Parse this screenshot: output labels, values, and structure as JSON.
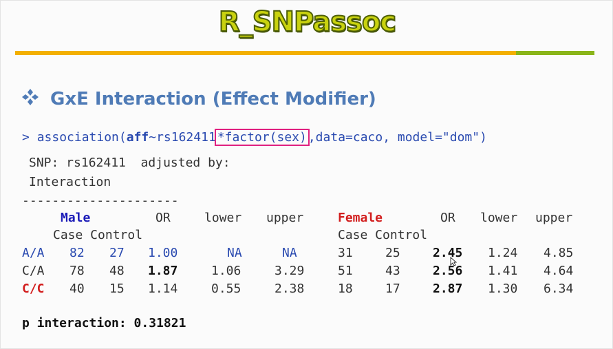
{
  "slide": {
    "title": "R_SNPassoc",
    "heading": "GxE Interaction (Effect Modifier)",
    "command": {
      "prompt": ">",
      "func_open": "association(",
      "aff": "aff",
      "formula_mid": "~rs162411",
      "boxed": "*factor(sex)",
      "tail": ",data=caco, model=\"dom\")"
    },
    "output": {
      "line1": "SNP: rs162411  adjusted by:",
      "line2": "Interaction",
      "dashes": "---------------------",
      "male_label": "Male",
      "female_label": "Female",
      "col_or": "OR",
      "col_lower": "lower",
      "col_upper": "upper",
      "col_or2": "OR",
      "col_lower2": "lower",
      "col_upper2": "upper",
      "subheader_male": "Case Control",
      "subheader_female": "Case Control",
      "rows": [
        {
          "genotype": "A/A",
          "m_case": "82",
          "m_ctrl": "27",
          "m_or": "1.00",
          "m_lower": "NA",
          "m_upper": "NA",
          "f_case": "31",
          "f_ctrl": "25",
          "f_or": "2.45",
          "f_lower": "1.24",
          "f_upper": "4.85"
        },
        {
          "genotype": "C/A",
          "m_case": "78",
          "m_ctrl": "48",
          "m_or": "1.87",
          "m_lower": "1.06",
          "m_upper": "3.29",
          "f_case": "51",
          "f_ctrl": "43",
          "f_or": "2.56",
          "f_lower": "1.41",
          "f_upper": "4.64"
        },
        {
          "genotype": "C/C",
          "m_case": "40",
          "m_ctrl": "15",
          "m_or": "1.14",
          "m_lower": "0.55",
          "m_upper": "2.38",
          "f_case": "18",
          "f_ctrl": "17",
          "f_or": "2.87",
          "f_lower": "1.30",
          "f_upper": "6.34"
        }
      ],
      "p_interaction": "p interaction: 0.31821"
    }
  },
  "colors": {
    "title_fill": "#c9d20f",
    "title_stroke": "#4d5e06",
    "bar_orange": "#f3b000",
    "bar_green": "#8ab51a",
    "heading": "#4f7bb6",
    "code_blue": "#2a4ab0",
    "box_magenta": "#e02080",
    "female_red": "#d21e1e"
  },
  "icons": {
    "bullet": "four-diamond-bullet-icon",
    "cursor": "mouse-cursor-icon"
  }
}
